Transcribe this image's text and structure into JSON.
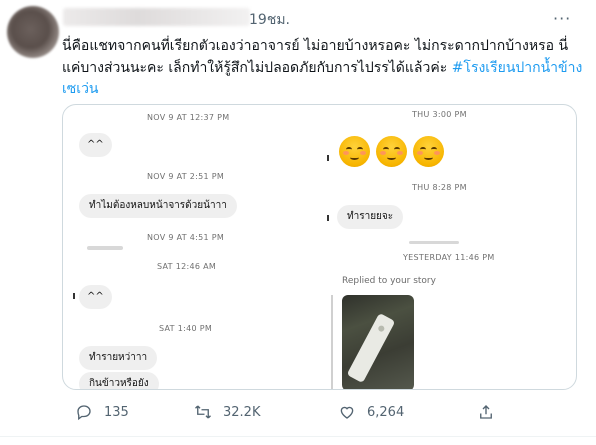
{
  "tweet": {
    "time": "19ชม.",
    "more": "···",
    "text": "นี่คือแชทจากคนที่เรียกตัวเองว่าอาจารย์ ไม่อายบ้างหรอคะ ไม่กระดากปากบ้างหรอ นี่แค่บางส่วนนะคะ เล็กทำให้รู้สึกไม่ปลอดภัยกับการไปรรได้แล้วค่ะ ",
    "hashtag": "#โรงเรียนปากน้ำข้างเซเว่น"
  },
  "chat_left": {
    "stamps": [
      "NOV 9 AT 12:37 PM",
      "NOV 9 AT 2:51 PM",
      "NOV 9 AT 4:51 PM",
      "SAT 12:46 AM",
      "SAT 1:40 PM"
    ],
    "bubbles": [
      "^^",
      "ทำไมต้องหลบหน้าจารด้วยน้าาา",
      "^^",
      "ทำรายหว่าาา",
      "กินข้าวหรือยัง"
    ]
  },
  "chat_right": {
    "stamps": [
      "THU 3:00 PM",
      "THU 8:28 PM",
      "YESTERDAY 11:46 PM"
    ],
    "emoji_names": [
      "smiling-face-icon",
      "smiling-face-icon",
      "smiling-face-icon"
    ],
    "bubble": "ทำรายยจะ",
    "replied_label": "Replied to your story"
  },
  "actions": {
    "replies": "135",
    "retweets": "32.2K",
    "likes": "6,264"
  },
  "colors": {
    "text": "#0f1419",
    "muted": "#536471",
    "accent": "#1d9bf0",
    "bubble": "#efefef"
  }
}
